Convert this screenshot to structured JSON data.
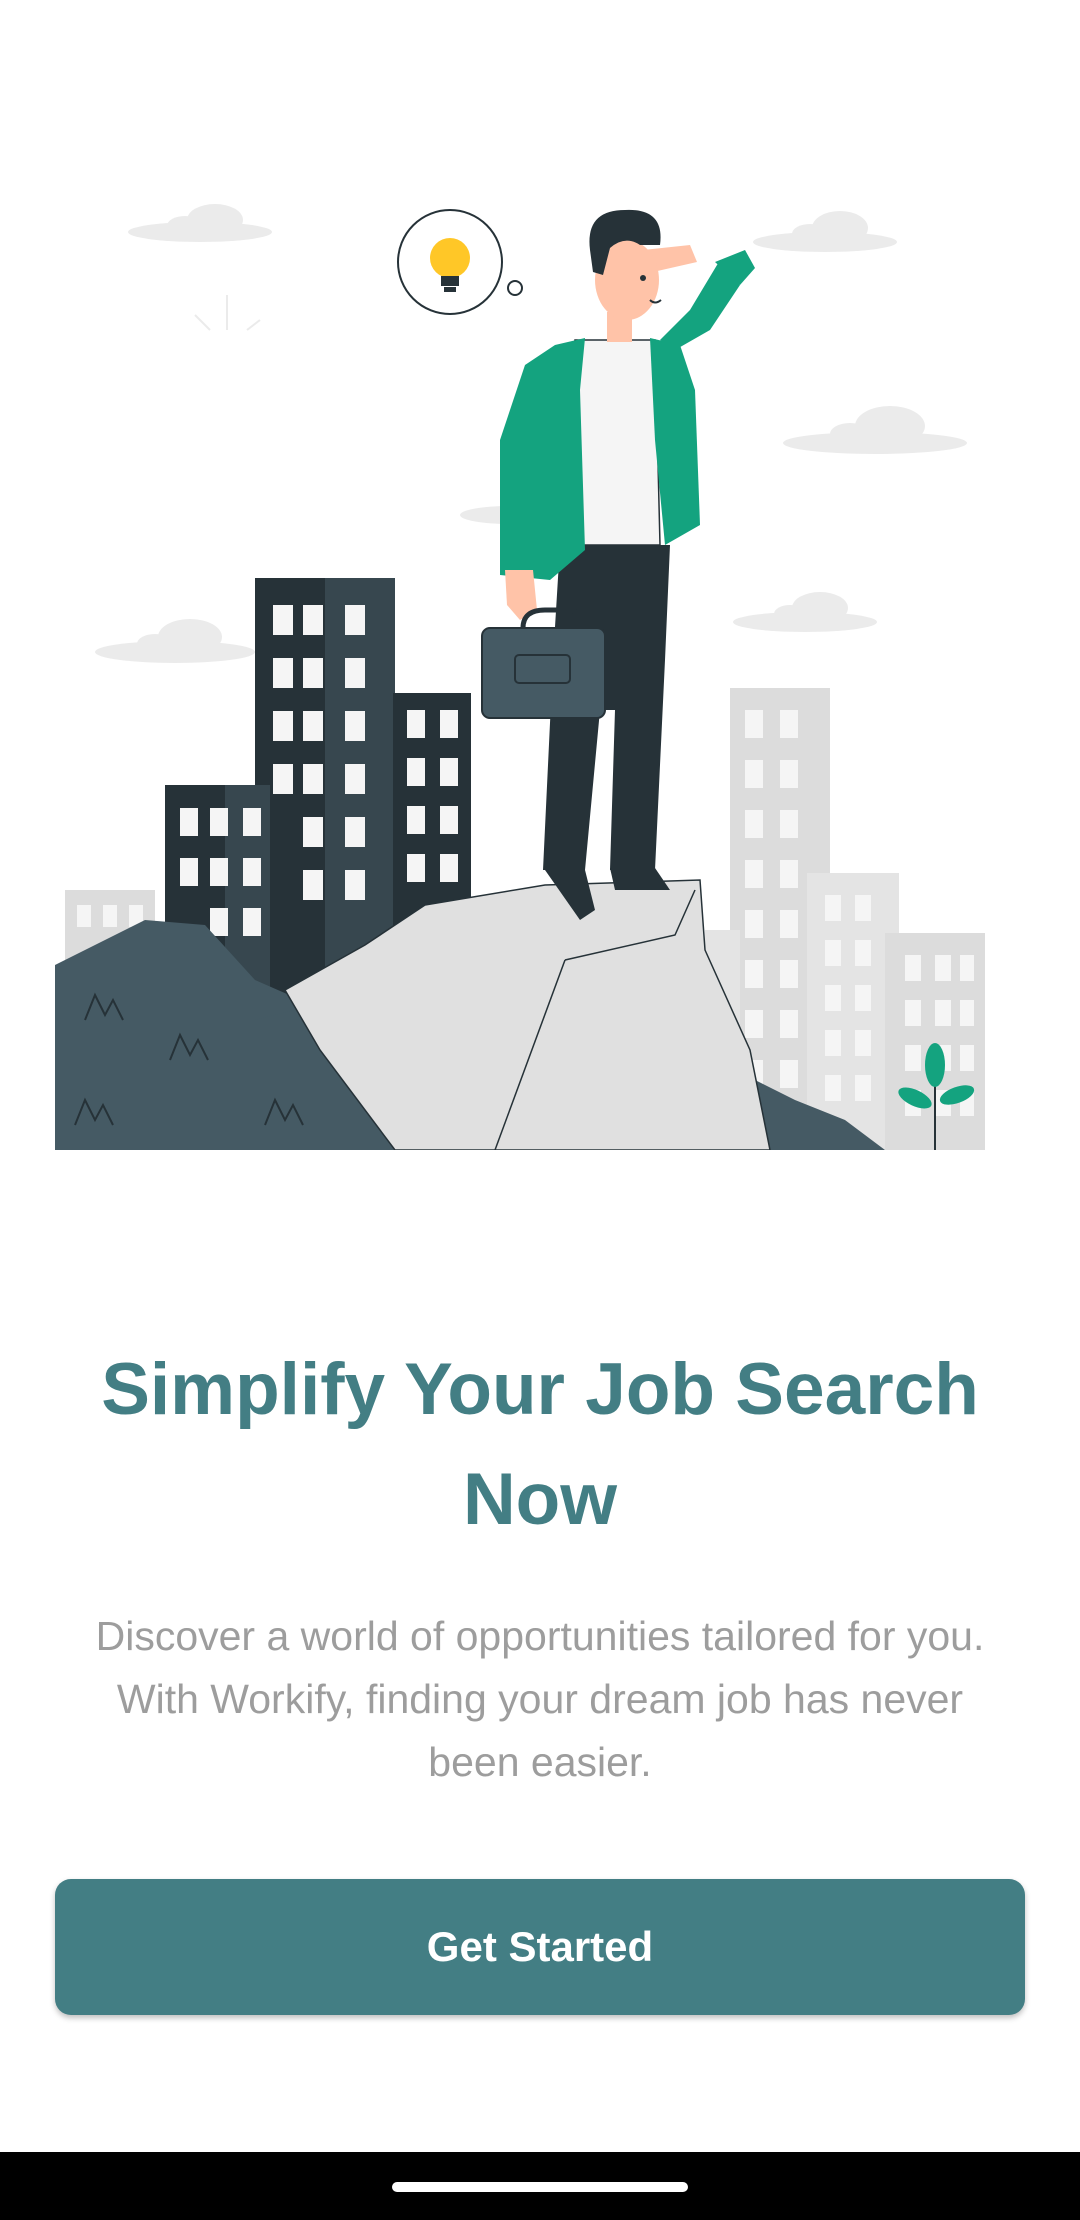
{
  "onboarding": {
    "illustration": "job-search-city-illustration",
    "title": "Simplify Your Job Search Now",
    "description": "Discover a world of opportunities tailored for you. With Workify, finding your dream job has never been easier.",
    "cta_label": "Get Started"
  },
  "colors": {
    "primary": "#437e84",
    "text_muted": "#9d9d9d",
    "accent_green": "#14a37f",
    "dark": "#263238",
    "background": "#ffffff"
  },
  "system": {
    "nav_handle": "home-gesture-bar"
  }
}
